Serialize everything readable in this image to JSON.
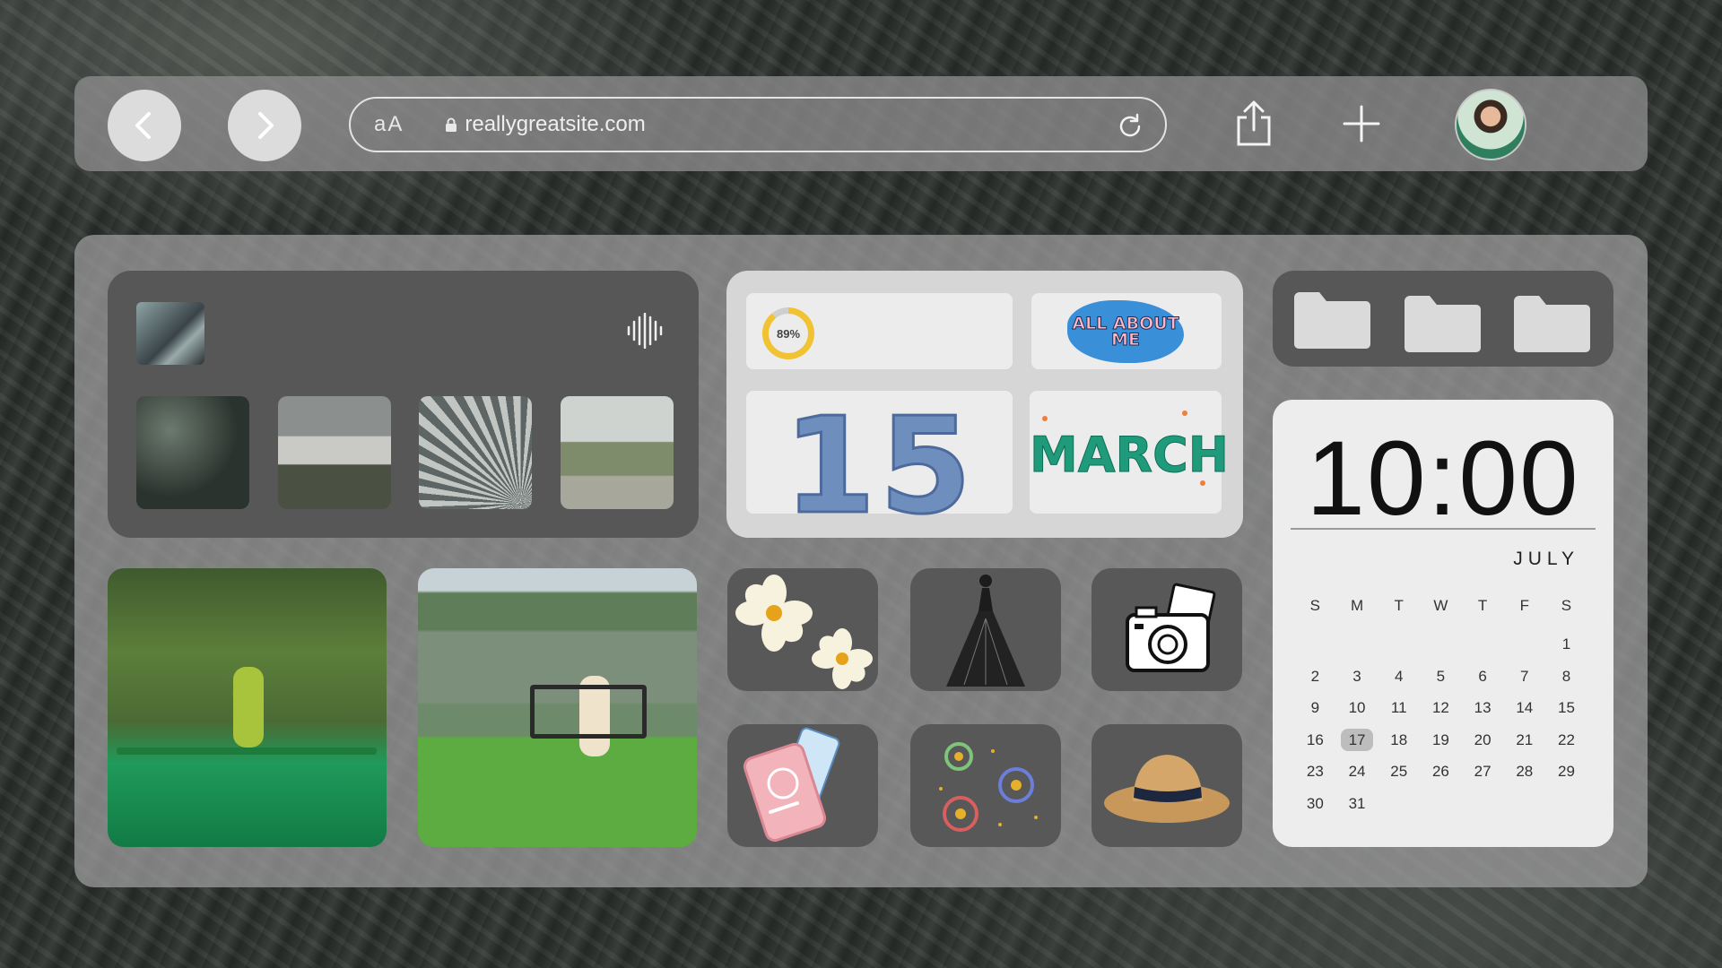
{
  "browser": {
    "back_icon": "chevron-left-icon",
    "forward_icon": "chevron-right-icon",
    "text_size_label": "aA",
    "url": "reallygreatsite.com",
    "reload_icon": "reload-icon",
    "share_icon": "share-icon",
    "new_tab_icon": "plus-icon",
    "avatar": "profile-photo"
  },
  "gallery": {
    "audio_icon": "sound-wave-icon",
    "photo_count": 4
  },
  "date_widget": {
    "progress_percent": 89,
    "progress_label": "89%",
    "sticker_text": "ALL ABOUT ME",
    "day": "15",
    "month": "MARCH"
  },
  "folders": {
    "count": 3
  },
  "clock": {
    "time": "10:00"
  },
  "calendar": {
    "month": "JULY",
    "weekdays": [
      "S",
      "M",
      "T",
      "W",
      "T",
      "F",
      "S"
    ],
    "weeks": [
      [
        "",
        "",
        "",
        "",
        "",
        "",
        "1"
      ],
      [
        "2",
        "3",
        "4",
        "5",
        "6",
        "7",
        "8"
      ],
      [
        "9",
        "10",
        "11",
        "12",
        "13",
        "14",
        "15"
      ],
      [
        "16",
        "17",
        "18",
        "19",
        "20",
        "21",
        "22"
      ],
      [
        "23",
        "24",
        "25",
        "26",
        "27",
        "28",
        "29"
      ],
      [
        "30",
        "31",
        "",
        "",
        "",
        "",
        ""
      ]
    ],
    "selected_day": "17"
  },
  "tiles": [
    {
      "icon": "daisy-flowers-icon"
    },
    {
      "icon": "gown-dress-icon"
    },
    {
      "icon": "camera-icon"
    },
    {
      "icon": "passport-tickets-icon"
    },
    {
      "icon": "flowers-doodle-icon"
    },
    {
      "icon": "straw-hat-icon"
    }
  ],
  "colors": {
    "progress_ring": "#f1c232",
    "day_number": "#6e8fbe",
    "month_text": "#1f9a7a",
    "sticker_blob": "#3a8fd9"
  }
}
